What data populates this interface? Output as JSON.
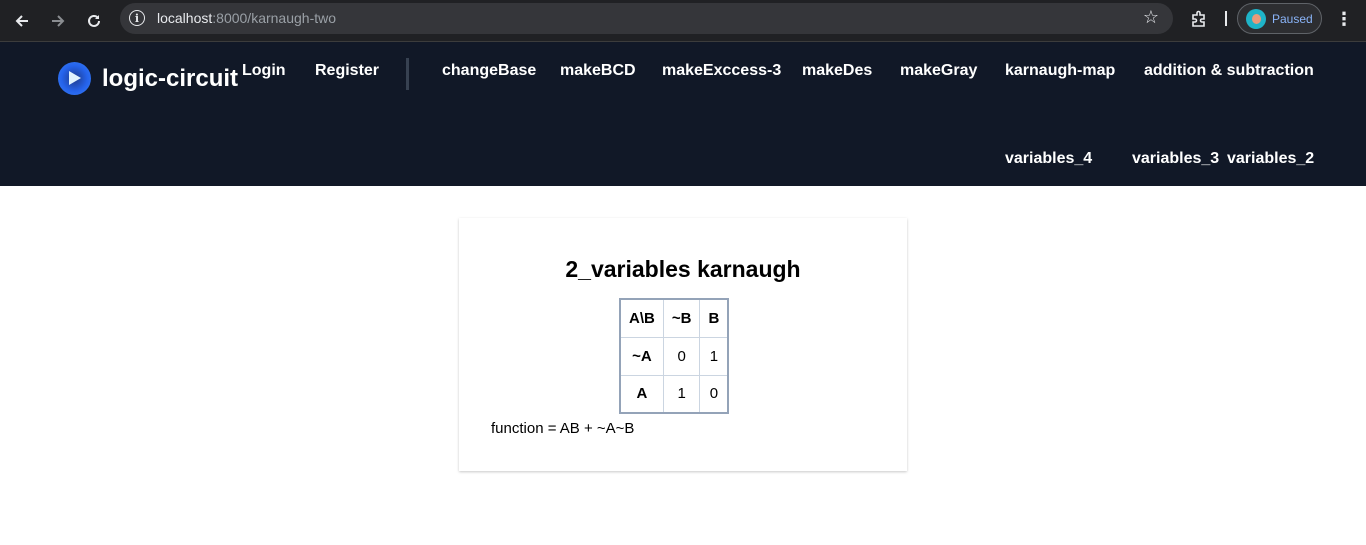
{
  "browser": {
    "back_icon": "arrow-left-icon",
    "forward_icon": "arrow-right-icon",
    "reload_icon": "reload-icon",
    "url_host": "localhost",
    "url_rest": ":8000/karnaugh-two",
    "profile_label": "Paused"
  },
  "nav": {
    "brand": "logic-circuit",
    "links": {
      "login": "Login",
      "register": "Register",
      "change_base": "changeBase",
      "make_bcd": "makeBCD",
      "make_excess3": "makeExccess-3",
      "make_des": "makeDes",
      "make_gray": "makeGray",
      "karnaugh_map": "karnaugh-map",
      "add_sub": "addition & subtraction",
      "variables_4": "variables_4",
      "variables_3": "variables_3",
      "variables_2": "variables_2"
    }
  },
  "main": {
    "title": "2_variables karnaugh",
    "table": {
      "corner": "A\\B",
      "col_headers": [
        "~B",
        "B"
      ],
      "rows": [
        {
          "header": "~A",
          "cells": [
            "0",
            "1"
          ]
        },
        {
          "header": "A",
          "cells": [
            "1",
            "0"
          ]
        }
      ]
    },
    "function_text": "function = AB + ~A~B"
  }
}
